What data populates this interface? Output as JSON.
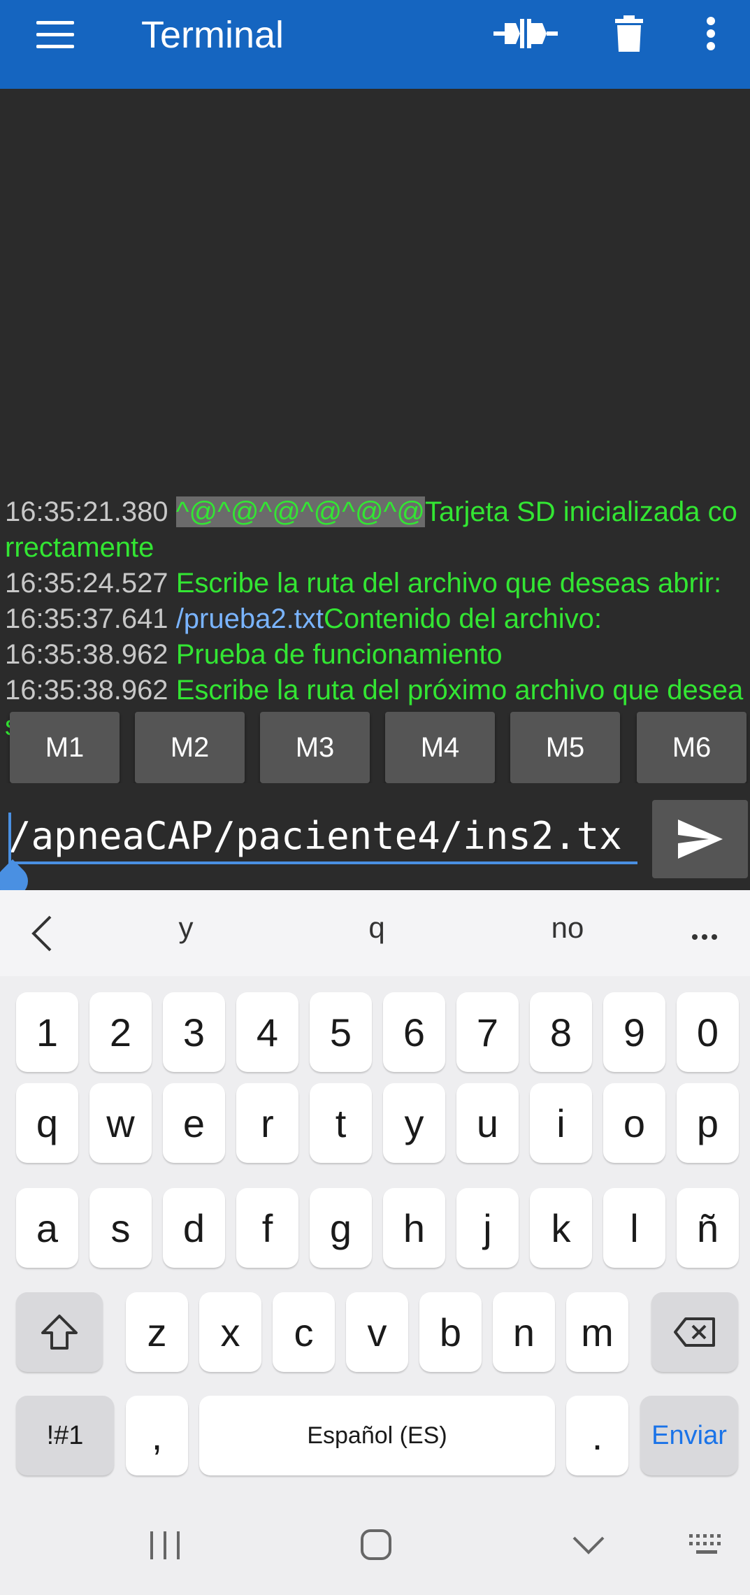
{
  "app_bar": {
    "title": "Terminal",
    "icons": [
      "menu-icon",
      "connect-icon",
      "trash-icon",
      "more-vert-icon"
    ],
    "color": "#1565c0"
  },
  "terminal": {
    "lines": [
      {
        "time": "16:35:21.380",
        "highlight": "^@^@^@^@^@^@",
        "text": "Tarjeta SD inicializada correctamente"
      },
      {
        "time": "16:35:24.527",
        "text": "Escribe la ruta del archivo que deseas abrir:"
      },
      {
        "time": "16:35:37.641",
        "sent": "/prueba2.txt",
        "text": "Contenido del archivo:"
      },
      {
        "time": "16:35:38.962",
        "text": "Prueba de funcionamiento"
      },
      {
        "time": "16:35:38.962",
        "text": "Escribe la ruta del próximo archivo que deseas abrir:"
      }
    ],
    "received_color": "#33e633",
    "sent_color": "#7ab4ff"
  },
  "macros": [
    "M1",
    "M2",
    "M3",
    "M4",
    "M5",
    "M6"
  ],
  "input": {
    "value": "/apneaCAP/paciente4/ins2.tx",
    "send_icon": "send-icon"
  },
  "keyboard": {
    "suggestions": [
      "y",
      "q",
      "no"
    ],
    "number_row": [
      "1",
      "2",
      "3",
      "4",
      "5",
      "6",
      "7",
      "8",
      "9",
      "0"
    ],
    "row1": [
      "q",
      "w",
      "e",
      "r",
      "t",
      "y",
      "u",
      "i",
      "o",
      "p"
    ],
    "row2": [
      "a",
      "s",
      "d",
      "f",
      "g",
      "h",
      "j",
      "k",
      "l",
      "ñ"
    ],
    "row3": [
      "z",
      "x",
      "c",
      "v",
      "b",
      "n",
      "m"
    ],
    "symbols_label": "!#1",
    "comma": ",",
    "space_label": "Español (ES)",
    "period": ".",
    "enter_label": "Enviar"
  }
}
